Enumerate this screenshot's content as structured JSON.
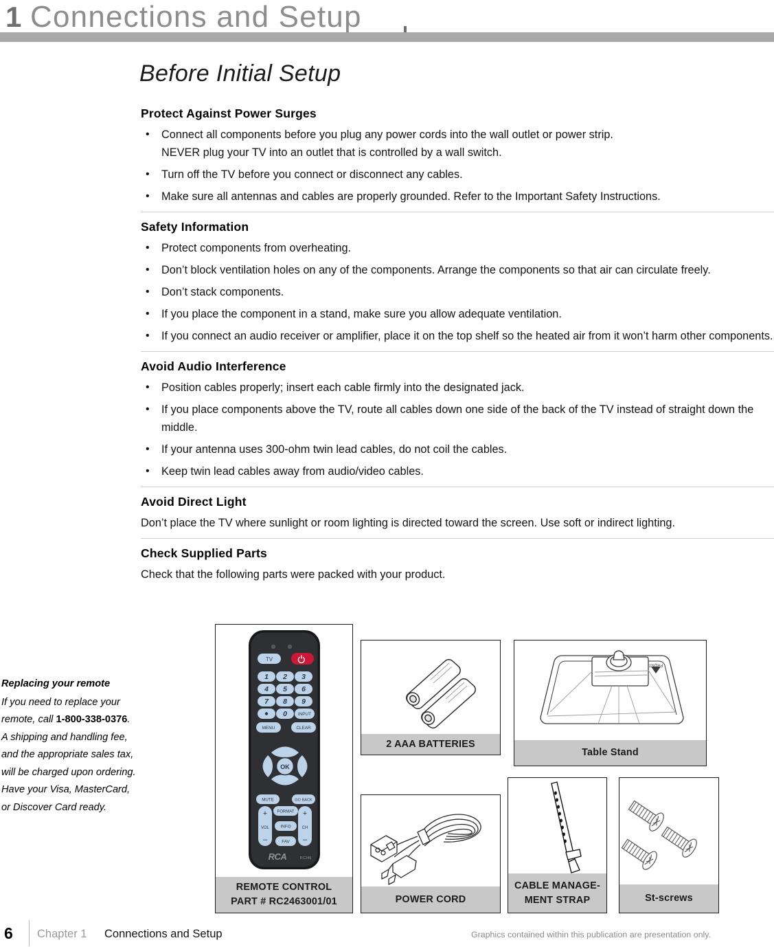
{
  "chapter": {
    "number": "1",
    "title": "Connections and Setup"
  },
  "section_title": "Before Initial Setup",
  "sections": [
    {
      "heading": "Protect Against Power Surges",
      "bullets": [
        "Connect all components before you plug any power cords into the wall outlet or power strip.",
        "Turn off the TV before you connect or disconnect any cables.",
        "Make sure all antennas and cables are properly grounded. Refer to the Important Safety Instructions."
      ],
      "bullet0_subline": "NEVER plug your TV into an outlet that is controlled by a wall switch."
    },
    {
      "heading": "Safety Information",
      "bullets": [
        "Protect components from overheating.",
        "Don’t block ventilation holes on any of the components. Arrange the components so that air can circulate freely.",
        "Don’t stack components.",
        "If you place the component in a stand, make sure you allow adequate ventilation.",
        "If you connect an audio receiver or amplifier, place it on the top shelf so the heated air from it won’t harm other components."
      ]
    },
    {
      "heading": "Avoid Audio Interference",
      "bullets": [
        "Position cables properly; insert each cable firmly into the designated jack.",
        "If you place components above the TV, route all cables down one side of the back of the TV instead of straight down the middle.",
        "If your antenna uses 300-ohm twin lead cables, do not coil the cables.",
        "Keep twin lead cables away from audio/video cables."
      ]
    },
    {
      "heading": "Avoid Direct Light",
      "paragraph": "Don’t place the TV where sunlight or room lighting is directed toward the screen. Use soft or indirect lighting."
    },
    {
      "heading": "Check Supplied Parts",
      "paragraph": "Check that the following parts were packed with your product."
    }
  ],
  "sidenote": {
    "title": "Replacing your remote",
    "text_before": "If you need to replace your remote, call ",
    "phone": "1-800-338-0376",
    "text_after": ".  A shipping and handling fee, and the appropriate sales tax, will be charged upon ordering.  Have your Visa, MasterCard, or Discover Card ready."
  },
  "parts": {
    "remote": {
      "caption_line1": "REMOTE CONTROL",
      "caption_line2_prefix": "PART # ",
      "caption_line2_part": "RC2463001/01",
      "buttons": {
        "tv": "TV",
        "power": "power-icon",
        "keys": [
          "1",
          "2",
          "3",
          "4",
          "5",
          "6",
          "7",
          "8",
          "9",
          "•",
          "0",
          "INPUT"
        ],
        "menu": "MENU",
        "clear": "CLEAR",
        "ok": "OK",
        "mute": "MUTE",
        "goback": "GO BACK",
        "format": "FORMAT",
        "info": "INFO",
        "fav": "FAV",
        "vol": "VOL",
        "ch": "CH",
        "plus": "+",
        "minus": "–",
        "brand": "RCA",
        "model": "RC246"
      }
    },
    "batteries": {
      "caption": "2 AAA BATTERIES"
    },
    "stand": {
      "caption": "Table Stand",
      "front_label": "FRONT"
    },
    "cord": {
      "caption": "POWER CORD"
    },
    "strap": {
      "caption_line1": "CABLE MANAGE-",
      "caption_line2": "MENT STRAP"
    },
    "screws": {
      "caption": "St-screws"
    }
  },
  "footer": {
    "page": "6",
    "chapter_label": "Chapter 1",
    "chapter_name": "Connections and Setup",
    "notice": "Graphics contained within this publication are presentation only."
  },
  "colors": {
    "bar_gray": "#a8a8a8",
    "caption_gray": "#c8c8c8",
    "remote_body": "#2e3033",
    "remote_button": "#bcd3ea",
    "power_red": "#cc1836"
  }
}
